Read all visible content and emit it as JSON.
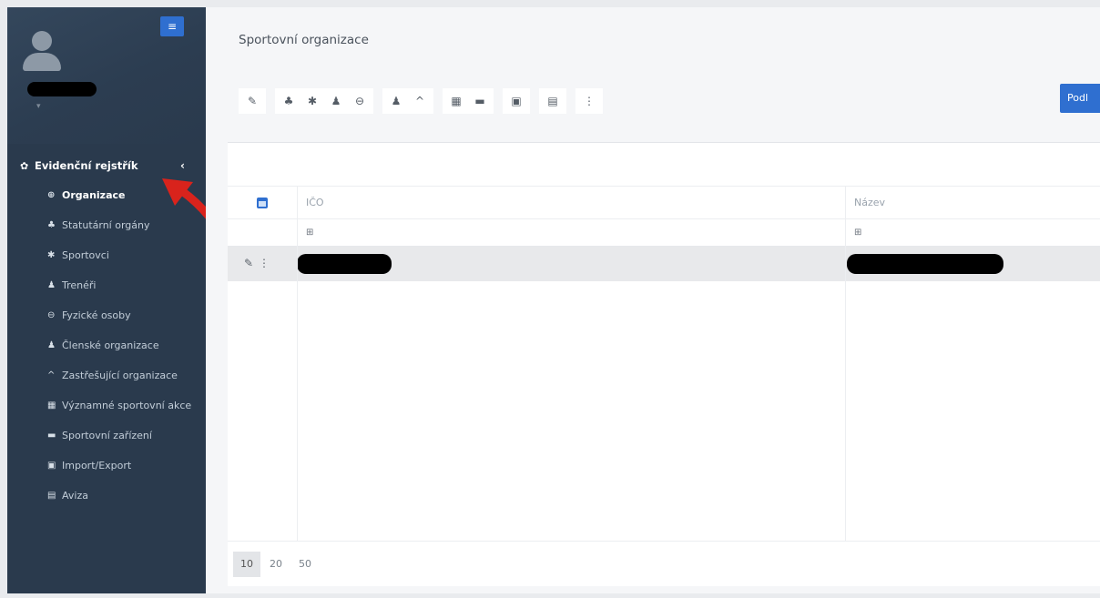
{
  "sidebar": {
    "username": "",
    "section_title": "Evidenční rejstřík",
    "items": [
      {
        "label": "Organizace",
        "icon": "globe-icon",
        "glyph": "⊕",
        "active": true
      },
      {
        "label": "Statutární orgány",
        "icon": "sitemap-icon",
        "glyph": "♣",
        "active": false
      },
      {
        "label": "Sportovci",
        "icon": "running-icon",
        "glyph": "✱",
        "active": false
      },
      {
        "label": "Trenéři",
        "icon": "user-icon",
        "glyph": "♟",
        "active": false
      },
      {
        "label": "Fyzické osoby",
        "icon": "user-circle-icon",
        "glyph": "⊖",
        "active": false
      },
      {
        "label": "Členské organizace",
        "icon": "user-check-icon",
        "glyph": "♟",
        "active": false
      },
      {
        "label": "Zastřešující organizace",
        "icon": "caret-up-icon",
        "glyph": "^",
        "active": false
      },
      {
        "label": "Významné sportovní akce",
        "icon": "calendar-icon",
        "glyph": "▦",
        "active": false
      },
      {
        "label": "Sportovní zařízení",
        "icon": "building-icon",
        "glyph": "▬",
        "active": false
      },
      {
        "label": "Import/Export",
        "icon": "file-import-icon",
        "glyph": "▣",
        "active": false
      },
      {
        "label": "Aviza",
        "icon": "envelope-icon",
        "glyph": "▤",
        "active": false
      }
    ]
  },
  "main": {
    "title": "Sportovní organizace",
    "primary_button": "Podl",
    "toolbar": [
      [
        "✎"
      ],
      [
        "♣",
        "✱",
        "♟",
        "⊖"
      ],
      [
        "♟",
        "^"
      ],
      [
        "▦",
        "▬"
      ],
      [
        "▣"
      ],
      [
        "▤"
      ],
      [
        "⋮"
      ]
    ],
    "grid": {
      "columns": [
        "IČO",
        "Název"
      ],
      "filter_glyph": "⊞",
      "row_actions": "✎⋮"
    },
    "page_sizes": [
      "10",
      "20",
      "50"
    ],
    "active_page_size": "10"
  },
  "colors": {
    "sidebar_bg": "#2a3a4d",
    "accent": "#2f6fd0",
    "annotation_arrow": "#d9231c"
  }
}
